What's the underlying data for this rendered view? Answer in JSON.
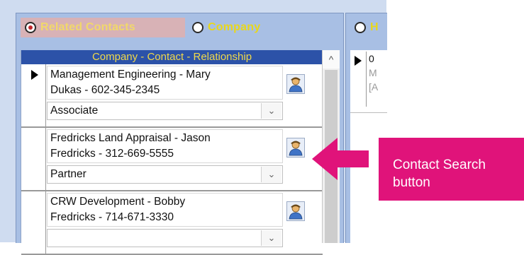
{
  "tabs": {
    "related_contacts": "Related Contacts",
    "company": "Company",
    "right_tab_partial": "H"
  },
  "grid": {
    "header": "Company - Contact - Relationship",
    "scroll_up_symbol": "^",
    "rows": [
      {
        "line1": "Management Engineering - Mary",
        "line2": "Dukas - 602-345-2345",
        "relationship": "Associate",
        "selected": true
      },
      {
        "line1": "Fredricks Land Appraisal - Jason",
        "line2": "Fredricks - 312-669-5555",
        "relationship": "Partner",
        "selected": false
      },
      {
        "line1": "CRW Development - Bobby",
        "line2": "Fredricks - 714-671-3330",
        "relationship": "",
        "selected": false
      }
    ]
  },
  "right_grid": {
    "row_text_1": "0",
    "row_text_2": "M",
    "row_text_3": "[A"
  },
  "callout": {
    "line1": "Contact Search",
    "line2": "button",
    "color": "#e0137a"
  },
  "icons": {
    "contact_search": "person-icon",
    "dropdown": "chevron-down-icon"
  }
}
